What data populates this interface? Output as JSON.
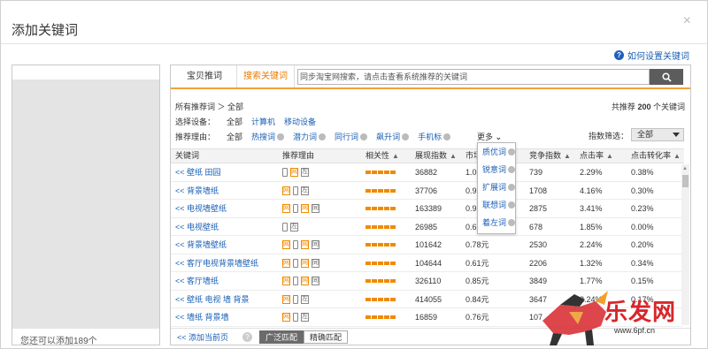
{
  "dialog": {
    "title": "添加关键词",
    "close": "×",
    "help_link": "如何设置关键词"
  },
  "left": {
    "footer": "您还可以添加189个"
  },
  "tabs": [
    {
      "label": "宝贝推词"
    },
    {
      "label": "搜索关键词"
    }
  ],
  "search": {
    "value": "同步淘宝网搜索，请点击查看系统推荐的关键词"
  },
  "breadcrumb": "所有推荐词 ＞ 全部",
  "total": {
    "prefix": "共推荐",
    "count": "200",
    "suffix": "个关键词"
  },
  "device_filter": {
    "label": "选择设备：",
    "options": [
      "全部",
      "计算机",
      "移动设备"
    ]
  },
  "reason_filter": {
    "label": "推荐理由：",
    "options": [
      "全部",
      "热搜词",
      "潜力词",
      "同行词",
      "飙升词",
      "手机标"
    ],
    "more": "更多"
  },
  "index_filter": {
    "label": "指数筛选：",
    "selected": "全部"
  },
  "more_popup": [
    "质优词",
    "锐意词",
    "扩展词",
    "联想词",
    "着左词"
  ],
  "columns": [
    "关键词",
    "推荐理由",
    "相关性",
    "展现指数",
    "市场",
    "竞争指数",
    "点击率",
    "点击转化率"
  ],
  "rows": [
    {
      "keyword": "<< 壁纸 田园",
      "reasons": [
        "mobile",
        "net",
        "doc"
      ],
      "impression": "36882",
      "market": "1.0",
      "competition": "739",
      "ctr": "2.29%",
      "cvr": "0.38%"
    },
    {
      "keyword": "<< 背景墙纸",
      "reasons": [
        "net",
        "mobile",
        "doc"
      ],
      "impression": "37706",
      "market": "0.9",
      "competition": "1708",
      "ctr": "4.16%",
      "cvr": "0.30%"
    },
    {
      "keyword": "<< 电视墙壁纸",
      "reasons": [
        "net",
        "mobile",
        "net",
        "tonggu"
      ],
      "impression": "163389",
      "market": "0.9",
      "competition": "2875",
      "ctr": "3.41%",
      "cvr": "0.23%"
    },
    {
      "keyword": "<< 电视壁纸",
      "reasons": [
        "mobile",
        "doc"
      ],
      "impression": "26985",
      "market": "0.6",
      "competition": "678",
      "ctr": "1.85%",
      "cvr": "0.00%"
    },
    {
      "keyword": "<< 背景墙壁纸",
      "reasons": [
        "net",
        "mobile",
        "net",
        "tonggu"
      ],
      "impression": "101642",
      "market": "0.78元",
      "competition": "2530",
      "ctr": "2.24%",
      "cvr": "0.20%"
    },
    {
      "keyword": "<< 客厅电视背景墙壁纸",
      "reasons": [
        "net",
        "mobile",
        "net",
        "tonggu"
      ],
      "impression": "104644",
      "market": "0.61元",
      "competition": "2206",
      "ctr": "1.32%",
      "cvr": "0.34%"
    },
    {
      "keyword": "<< 客厅墙纸",
      "reasons": [
        "net",
        "mobile",
        "net",
        "tonggu"
      ],
      "impression": "326110",
      "market": "0.85元",
      "competition": "3849",
      "ctr": "1.77%",
      "cvr": "0.15%"
    },
    {
      "keyword": "<< 壁纸 电视 墙 背景",
      "reasons": [
        "net",
        "mobile",
        "doc"
      ],
      "impression": "414055",
      "market": "0.84元",
      "competition": "3647",
      "ctr": "2.24%",
      "cvr": "0.17%"
    },
    {
      "keyword": "<< 墙纸 背景墙",
      "reasons": [
        "net",
        "mobile",
        "doc"
      ],
      "impression": "16859",
      "market": "0.76元",
      "competition": "107",
      "ctr": "",
      "cvr": ""
    }
  ],
  "footer": {
    "add_page": "<< 添加当前页",
    "broad": "广泛匹配",
    "exact": "精确匹配"
  },
  "watermark": {
    "text": "乐发网",
    "url": "www.6pf.cn"
  },
  "colors": {
    "accent_orange": "#f08a00",
    "link_blue": "#1a5fb4",
    "brand_red": "#d7262b"
  }
}
